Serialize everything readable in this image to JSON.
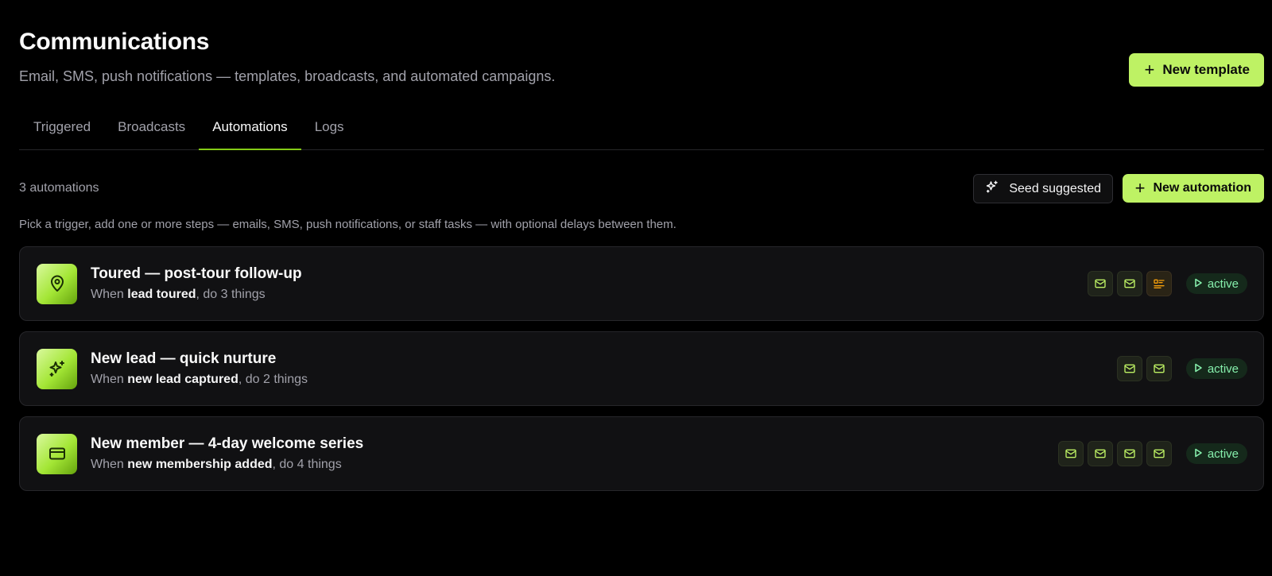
{
  "header": {
    "title": "Communications",
    "subtitle": "Email, SMS, push notifications — templates, broadcasts, and automated campaigns.",
    "new_template_label": "New template"
  },
  "tabs": [
    {
      "label": "Triggered",
      "active": false
    },
    {
      "label": "Broadcasts",
      "active": false
    },
    {
      "label": "Automations",
      "active": true
    },
    {
      "label": "Logs",
      "active": false
    }
  ],
  "toolbar": {
    "count_label": "3 automations",
    "seed_label": "Seed suggested",
    "new_automation_label": "New automation"
  },
  "hint": "Pick a trigger, add one or more steps — emails, SMS, push notifications, or staff tasks — with optional delays between them.",
  "automations": [
    {
      "title": "Toured — post-tour follow-up",
      "sub_prefix": "When ",
      "trigger": "lead toured",
      "sub_suffix": ", do 3 things",
      "icon": "map-pin-icon",
      "steps": [
        "mail-icon",
        "mail-icon",
        "task-list-icon"
      ],
      "status": "active"
    },
    {
      "title": "New lead — quick nurture",
      "sub_prefix": "When ",
      "trigger": "new lead captured",
      "sub_suffix": ", do 2 things",
      "icon": "sparkles-icon",
      "steps": [
        "mail-icon",
        "mail-icon"
      ],
      "status": "active"
    },
    {
      "title": "New member — 4-day welcome series",
      "sub_prefix": "When ",
      "trigger": "new membership added",
      "sub_suffix": ", do 4 things",
      "icon": "credit-card-icon",
      "steps": [
        "mail-icon",
        "mail-icon",
        "mail-icon",
        "mail-icon"
      ],
      "status": "active"
    }
  ],
  "colors": {
    "accent": "#bef264",
    "status_text": "#86efac",
    "task_icon": "#f59e0b"
  }
}
